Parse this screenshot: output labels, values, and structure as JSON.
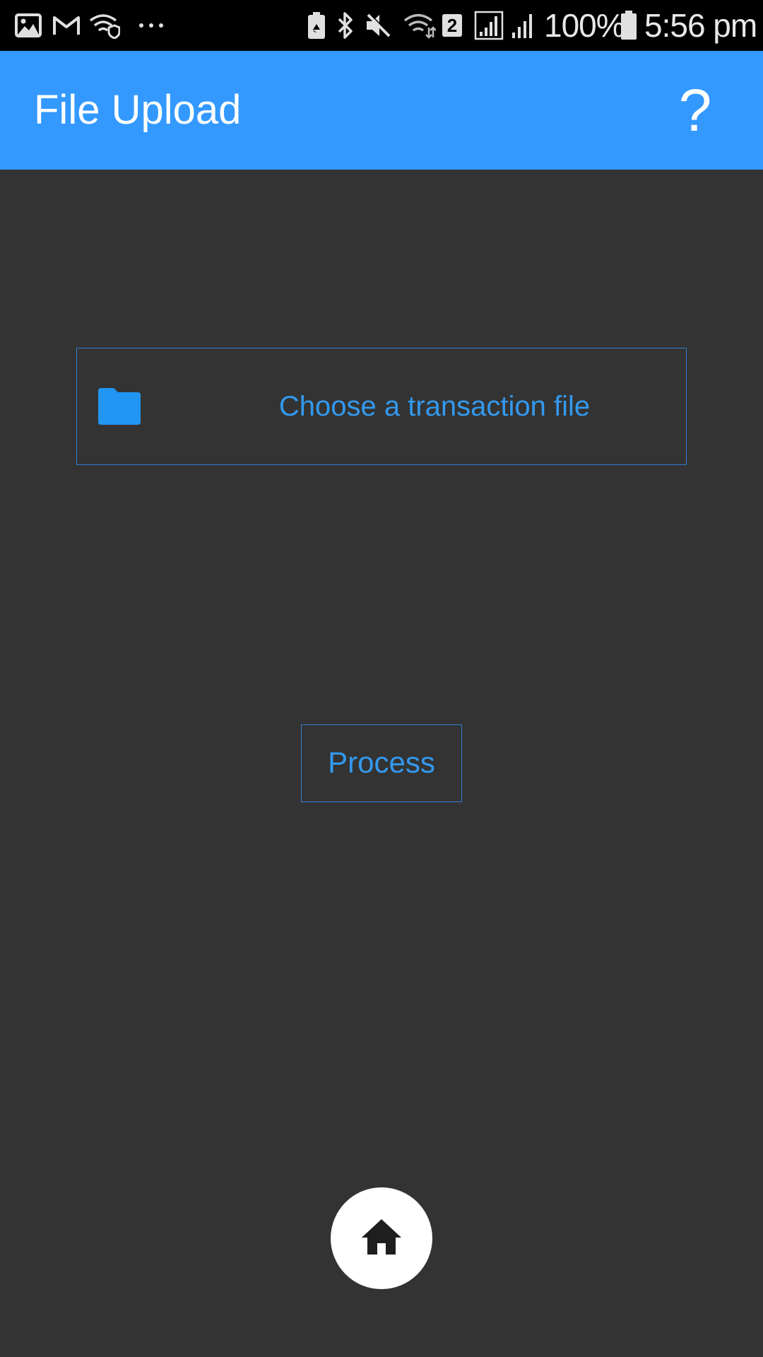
{
  "status_bar": {
    "battery_percent": "100%",
    "time": "5:56 pm",
    "sim_slot": "2",
    "left_icons": [
      "gallery-icon",
      "gmail-icon",
      "secure-wifi-icon",
      "more-dots-icon"
    ],
    "right_icons": [
      "battery-saver-icon",
      "bluetooth-icon",
      "mute-icon",
      "wifi-icon",
      "sim-icon",
      "signal-icon",
      "signal-icon",
      "battery-icon"
    ]
  },
  "app_bar": {
    "title": "File Upload",
    "help_label": "?"
  },
  "file_chooser": {
    "label": "Choose a transaction file",
    "icon": "folder-icon"
  },
  "process_button": {
    "label": "Process"
  },
  "home_button": {
    "icon": "home-icon"
  },
  "colors": {
    "app_bar": "#3399ff",
    "background": "#333333",
    "accent": "#3399ee",
    "status_bar": "#000000"
  }
}
